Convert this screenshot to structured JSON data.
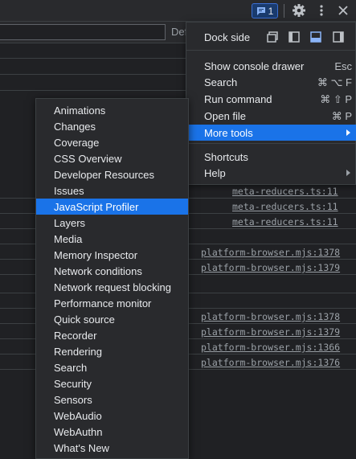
{
  "toolbar": {
    "issues_count": "1"
  },
  "filter": {
    "levels_label": "Def"
  },
  "console": {
    "links": [
      "meta-reducers.ts:11",
      "meta-reducers.ts:11",
      "meta-reducers.ts:11",
      "platform-browser.mjs:1378",
      "platform-browser.mjs:1379",
      "platform-browser.mjs:1378",
      "platform-browser.mjs:1379",
      "platform-browser.mjs:1366",
      "platform-browser.mjs:1376"
    ]
  },
  "menu": {
    "dock_side_label": "Dock side",
    "items": [
      {
        "label": "Show console drawer",
        "shortcut": "Esc"
      },
      {
        "label": "Search",
        "shortcut": "⌘ ⌥ F"
      },
      {
        "label": "Run command",
        "shortcut": "⌘ ⇧ P"
      },
      {
        "label": "Open file",
        "shortcut": "⌘ P"
      },
      {
        "label": "More tools",
        "shortcut": ""
      },
      {
        "label": "Shortcuts",
        "shortcut": ""
      },
      {
        "label": "Help",
        "shortcut": ""
      }
    ]
  },
  "more_tools": {
    "items": [
      "Animations",
      "Changes",
      "Coverage",
      "CSS Overview",
      "Developer Resources",
      "Issues",
      "JavaScript Profiler",
      "Layers",
      "Media",
      "Memory Inspector",
      "Network conditions",
      "Network request blocking",
      "Performance monitor",
      "Quick source",
      "Recorder",
      "Rendering",
      "Search",
      "Security",
      "Sensors",
      "WebAudio",
      "WebAuthn",
      "What's New"
    ],
    "highlighted": "JavaScript Profiler"
  },
  "colors": {
    "highlight": "#1a73e8",
    "background": "#202124",
    "menu_background": "#292a2d"
  }
}
